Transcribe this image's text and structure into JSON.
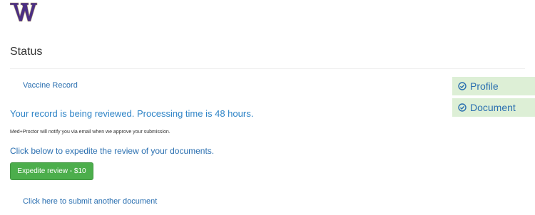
{
  "header": {
    "logo_letter": "W",
    "brand_color": "#4b2e83",
    "brand_accent": "#b7a57a"
  },
  "main": {
    "title": "Status",
    "record_link": "Vaccine Record",
    "review_message": "Your record is being reviewed. Processing time is 48 hours.",
    "notify_message": "Med+Proctor will notify you via email when we approve your submission.",
    "expedite_message": "Click below to expedite the review of your documents.",
    "expedite_button": "Expedite review - $10",
    "submit_link": "Click here to submit another document"
  },
  "steps": [
    {
      "label": "Profile",
      "icon": "check-circle-icon",
      "state": "complete"
    },
    {
      "label": "Document",
      "icon": "check-circle-icon",
      "state": "complete"
    }
  ],
  "colors": {
    "link": "#2a6fb0",
    "button": "#4cae4c",
    "step_bg": "#ddefd6"
  }
}
